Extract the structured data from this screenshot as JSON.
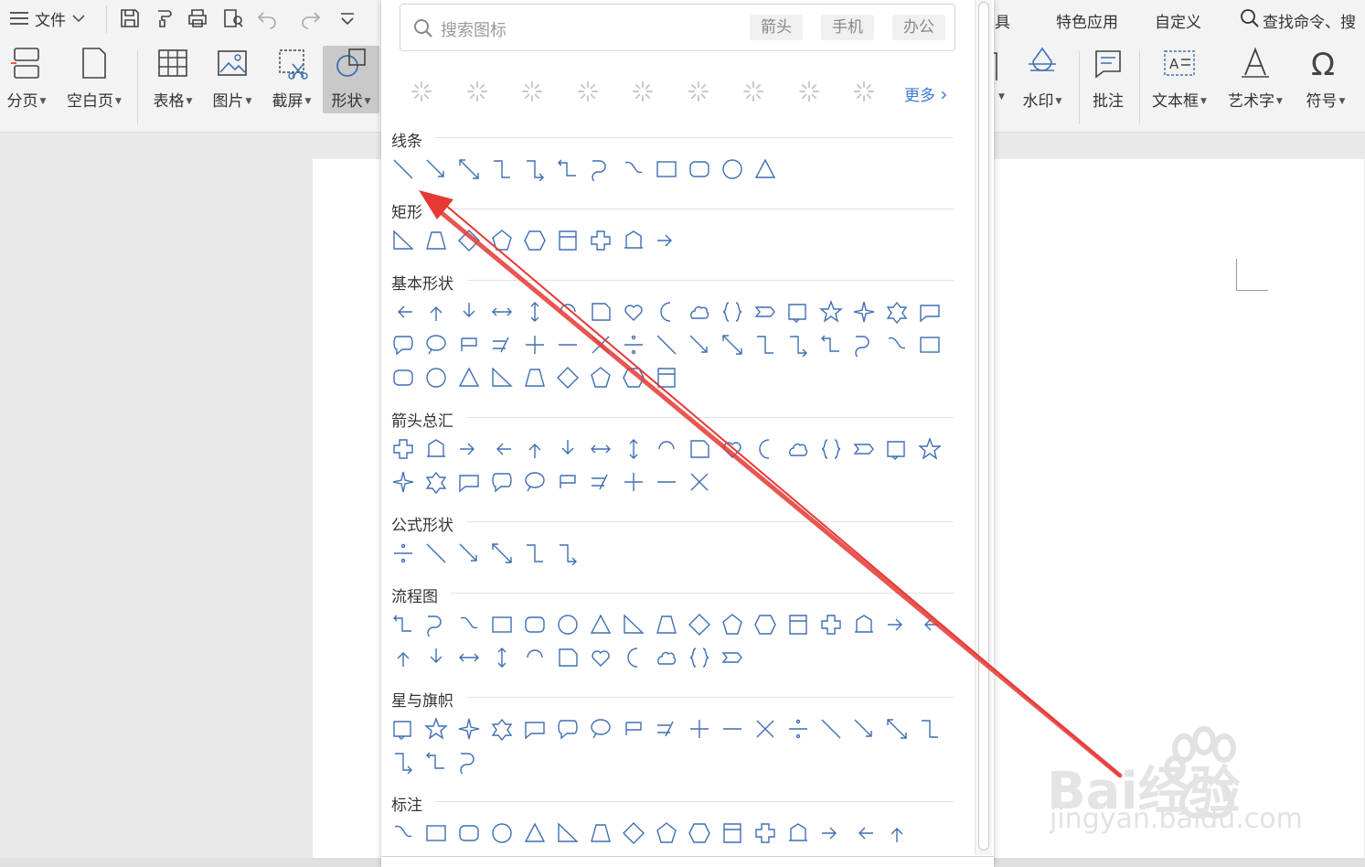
{
  "topbar": {
    "file_menu": "文件",
    "right_menus": [
      "具",
      "特色应用",
      "自定义",
      "查找命令、搜"
    ]
  },
  "ribbon": {
    "tools_left": [
      {
        "label": "分页",
        "icon": "page-break-icon",
        "dropdown": true
      },
      {
        "label": "空白页",
        "icon": "blank-page-icon",
        "dropdown": true
      },
      {
        "label": "表格",
        "icon": "table-icon",
        "dropdown": true
      },
      {
        "label": "图片",
        "icon": "picture-icon",
        "dropdown": true
      },
      {
        "label": "截屏",
        "icon": "screenshot-icon",
        "dropdown": true
      },
      {
        "label": "形状",
        "icon": "shapes-icon",
        "dropdown": true
      }
    ],
    "tools_right": [
      {
        "label": "水印",
        "icon": "watermark-icon",
        "dropdown": true
      },
      {
        "label": "批注",
        "icon": "comment-icon",
        "dropdown": false
      },
      {
        "label": "文本框",
        "icon": "textbox-icon",
        "dropdown": true
      },
      {
        "label": "艺术字",
        "icon": "wordart-icon",
        "dropdown": true
      },
      {
        "label": "符号",
        "icon": "symbol-icon",
        "dropdown": true
      }
    ]
  },
  "panel": {
    "search_placeholder": "搜索图标",
    "tags": [
      "箭头",
      "手机",
      "办公"
    ],
    "more_label": "更多",
    "sections": [
      {
        "title": "线条",
        "rows": [
          12
        ]
      },
      {
        "title": "矩形",
        "rows": [
          9
        ]
      },
      {
        "title": "基本形状",
        "rows": [
          17,
          17,
          9
        ]
      },
      {
        "title": "箭头总汇",
        "rows": [
          17,
          10
        ]
      },
      {
        "title": "公式形状",
        "rows": [
          6
        ]
      },
      {
        "title": "流程图",
        "rows": [
          17,
          11
        ]
      },
      {
        "title": "星与旗帜",
        "rows": [
          17,
          3
        ]
      },
      {
        "title": "标注",
        "rows": [
          16
        ]
      }
    ]
  },
  "watermark": {
    "text": "Bai经验",
    "sub": "jingyan.baidu.com"
  },
  "colors": {
    "accent": "#3c79d9",
    "shape_stroke": "#3f6fb3",
    "arrow": "#e53935"
  }
}
